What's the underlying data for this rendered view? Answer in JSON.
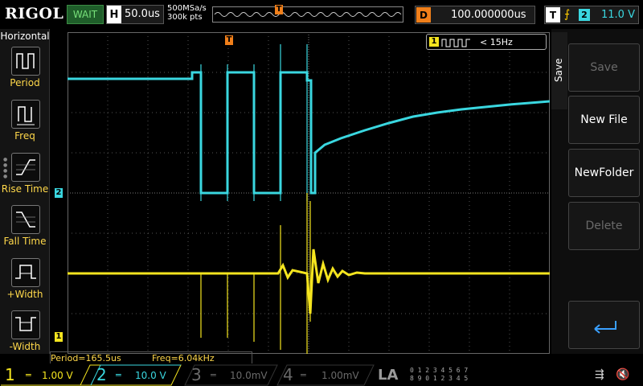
{
  "brand": "RIGOL",
  "run_status": "WAIT",
  "horizontal": {
    "key": "H",
    "timebase": "50.0us"
  },
  "sample": {
    "rate": "500MSa/s",
    "points": "300k pts"
  },
  "trigger_position_marker": "T",
  "delay": {
    "key": "D",
    "value": "100.000000us"
  },
  "trigger": {
    "key": "T",
    "edge_icon": "rising-edge-icon",
    "source": "2",
    "level": "11.0 V"
  },
  "left_menu": {
    "title": "Horizontal",
    "items": [
      {
        "label": "Period",
        "icon": "period-icon"
      },
      {
        "label": "Freq",
        "icon": "freq-icon"
      },
      {
        "label": "Rise Time",
        "icon": "rise-time-icon"
      },
      {
        "label": "Fall Time",
        "icon": "fall-time-icon"
      },
      {
        "label": "+Width",
        "icon": "positive-width-icon"
      },
      {
        "label": "-Width",
        "icon": "negative-width-icon"
      }
    ]
  },
  "counter": {
    "channel": "1",
    "text": "< 15Hz"
  },
  "right_menu": {
    "tab": "Save",
    "buttons": [
      "Save",
      "New File",
      "NewFolder",
      "Delete"
    ]
  },
  "markers": {
    "ch2_ground": "2",
    "ch1_ground": "1",
    "trigger_level": "T"
  },
  "readout": {
    "period": "Period=165.5us",
    "freq": "Freq=6.04kHz"
  },
  "channels": [
    {
      "num": "1",
      "scale": "1.00 V",
      "color": "#f5e51f"
    },
    {
      "num": "2",
      "scale": "10.0 V",
      "color": "#3ad7e0"
    },
    {
      "num": "3",
      "scale": "10.0mV",
      "color": "#6a6a6a"
    },
    {
      "num": "4",
      "scale": "1.00mV",
      "color": "#6a6a6a"
    }
  ],
  "la": {
    "label": "LA",
    "rows": [
      "0 1 2 3  4 5 6 7",
      "8 9 0 1  2 3 4 5"
    ]
  },
  "colors": {
    "ch1": "#f5e51f",
    "ch2": "#3ad7e0",
    "trigger": "#f07f1a",
    "grid": "#555555"
  }
}
